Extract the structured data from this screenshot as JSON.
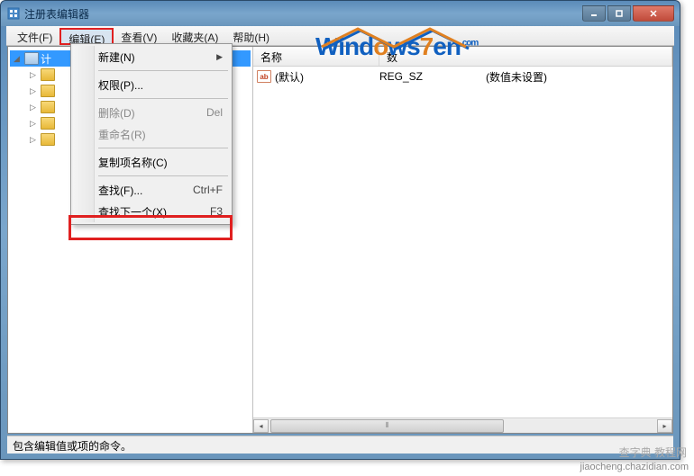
{
  "window": {
    "title": "注册表编辑器"
  },
  "menubar": {
    "items": [
      {
        "label": "文件(F)"
      },
      {
        "label": "编辑(E)"
      },
      {
        "label": "查看(V)"
      },
      {
        "label": "收藏夹(A)"
      },
      {
        "label": "帮助(H)"
      }
    ]
  },
  "edit_menu": {
    "items": [
      {
        "label": "新建(N)",
        "shortcut": "",
        "submenu": true,
        "disabled": false
      },
      {
        "label": "权限(P)...",
        "shortcut": "",
        "disabled": false
      },
      {
        "label": "删除(D)",
        "shortcut": "Del",
        "disabled": true
      },
      {
        "label": "重命名(R)",
        "shortcut": "",
        "disabled": true
      },
      {
        "label": "复制项名称(C)",
        "shortcut": "",
        "disabled": false
      },
      {
        "label": "查找(F)...",
        "shortcut": "Ctrl+F",
        "disabled": false
      },
      {
        "label": "查找下一个(X)",
        "shortcut": "F3",
        "disabled": false
      }
    ]
  },
  "tree": {
    "root": "计"
  },
  "list": {
    "columns": {
      "name": "名称",
      "data": "数"
    },
    "rows": [
      {
        "icon": "ab",
        "name": "(默认)",
        "type": "REG_SZ",
        "data": "(数值未设置)"
      }
    ]
  },
  "statusbar": {
    "text": "包含编辑值或项的命令。"
  },
  "watermark": {
    "site": "jiaocheng.chazidian.com",
    "brand": "查字典 教程网",
    "logo_text": "Windows7en",
    "logo_sup": ".com"
  }
}
